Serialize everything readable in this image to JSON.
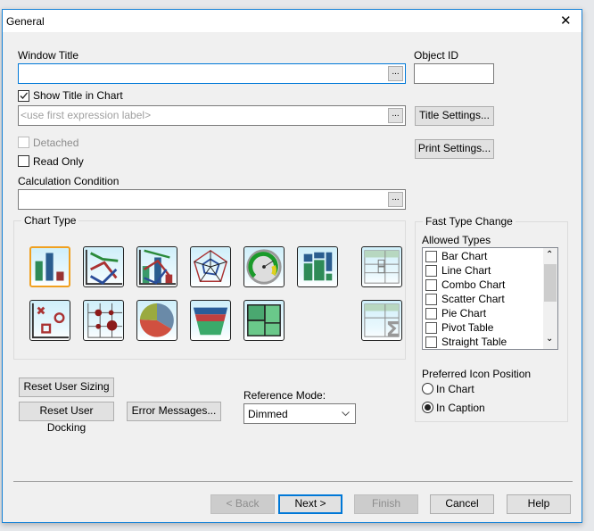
{
  "dialog": {
    "title": "General",
    "close": "✕"
  },
  "window_title": {
    "label": "Window Title",
    "value": "",
    "ellipsis": "..."
  },
  "object_id": {
    "label": "Object ID",
    "value": ""
  },
  "show_title": {
    "label": "Show Title in Chart",
    "checked": true,
    "placeholder": "<use first expression label>",
    "ellipsis": "..."
  },
  "title_settings": "Title Settings...",
  "print_settings": "Print Settings...",
  "detached": {
    "label": "Detached",
    "checked": false,
    "disabled": true
  },
  "read_only": {
    "label": "Read Only",
    "checked": false
  },
  "calc_condition": {
    "label": "Calculation Condition",
    "value": "",
    "ellipsis": "..."
  },
  "chart_type": {
    "label": "Chart Type",
    "selected": "bar-chart",
    "icons": [
      "bar-chart",
      "line-chart",
      "combo-chart",
      "radar-chart",
      "gauge-chart",
      "mekko-chart",
      "pivot-table",
      "scatter-chart",
      "grid-chart",
      "pie-chart",
      "funnel-chart",
      "block-chart",
      "straight-table"
    ]
  },
  "fast_type": {
    "label": "Fast Type Change",
    "allowed_label": "Allowed Types",
    "items": [
      "Bar Chart",
      "Line Chart",
      "Combo Chart",
      "Scatter Chart",
      "Pie Chart",
      "Pivot Table",
      "Straight Table"
    ],
    "icon_position_label": "Preferred Icon Position",
    "in_chart": "In Chart",
    "in_caption": "In Caption",
    "selected": "In Caption"
  },
  "reset_sizing": "Reset User Sizing",
  "reset_docking": "Reset User Docking",
  "error_messages": "Error Messages...",
  "reference_mode": {
    "label": "Reference Mode:",
    "value": "Dimmed"
  },
  "footer": {
    "back": "< Back",
    "next": "Next >",
    "finish": "Finish",
    "cancel": "Cancel",
    "help": "Help"
  }
}
